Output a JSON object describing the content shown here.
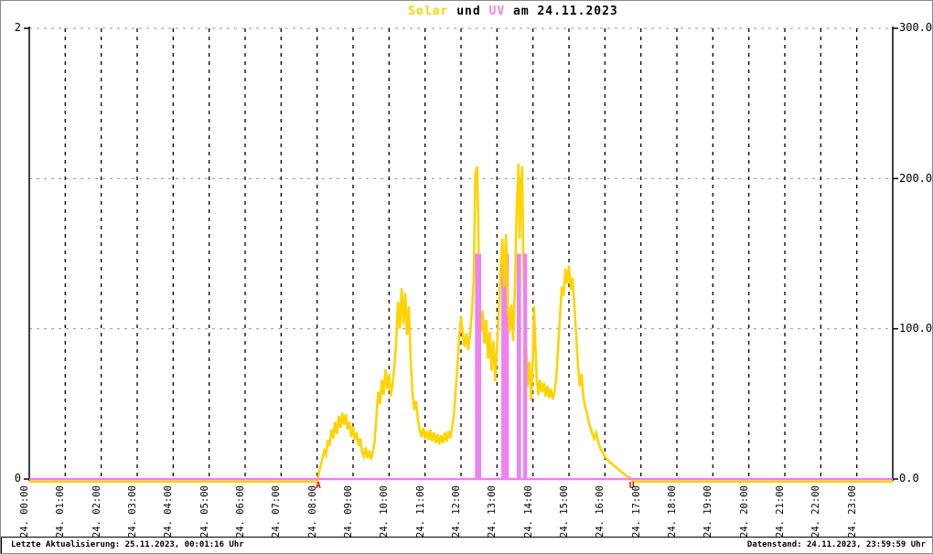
{
  "chart_data": {
    "type": "line",
    "title": "Solar und UV am 24.11.2023",
    "title_parts": [
      {
        "text": "Solar",
        "color": "#FFD300"
      },
      {
        "text": " und ",
        "color": "#000000"
      },
      {
        "text": "UV",
        "color": "#EE82EE"
      },
      {
        "text": " am 24.11.2023",
        "color": "#000000"
      }
    ],
    "grid": {
      "horizontal_style": "dashed-gray",
      "vertical_style": "dashed-black"
    },
    "legend_position": "none",
    "axes": {
      "left": {
        "series": "UV",
        "min": 0,
        "max": 2,
        "ticks": [
          "2",
          "0"
        ],
        "tick_values": [
          2,
          0
        ]
      },
      "right": {
        "series": "Solar",
        "min": 0,
        "max": 300,
        "ticks": [
          "300.0",
          "200.0",
          "100.0",
          "0.0"
        ],
        "tick_values": [
          300,
          200,
          100,
          0
        ],
        "gridline_values": [
          300,
          200,
          100
        ]
      },
      "x": {
        "min_hour": 0,
        "max_hour": 24,
        "tick_labels": [
          "24. 00:00",
          "24. 01:00",
          "24. 02:00",
          "24. 03:00",
          "24. 04:00",
          "24. 05:00",
          "24. 06:00",
          "24. 07:00",
          "24. 08:00",
          "24. 09:00",
          "24. 10:00",
          "24. 11:00",
          "24. 12:00",
          "24. 13:00",
          "24. 14:00",
          "24. 15:00",
          "24. 16:00",
          "24. 17:00",
          "24. 18:00",
          "24. 19:00",
          "24. 20:00",
          "24. 21:00",
          "24. 22:00",
          "24. 23:00"
        ]
      }
    },
    "series": [
      {
        "name": "Solar",
        "type": "line",
        "color": "#FFD300",
        "axis": "right",
        "points": [
          [
            0,
            0
          ],
          [
            8.0,
            0
          ],
          [
            8.05,
            4
          ],
          [
            8.1,
            9
          ],
          [
            8.15,
            14
          ],
          [
            8.2,
            19
          ],
          [
            8.25,
            16
          ],
          [
            8.3,
            26
          ],
          [
            8.35,
            22
          ],
          [
            8.4,
            33
          ],
          [
            8.45,
            27
          ],
          [
            8.5,
            38
          ],
          [
            8.55,
            30
          ],
          [
            8.6,
            42
          ],
          [
            8.65,
            34
          ],
          [
            8.7,
            44
          ],
          [
            8.75,
            36
          ],
          [
            8.8,
            43
          ],
          [
            8.85,
            33
          ],
          [
            8.9,
            38
          ],
          [
            8.95,
            28
          ],
          [
            9.0,
            35
          ],
          [
            9.05,
            26
          ],
          [
            9.1,
            31
          ],
          [
            9.15,
            22
          ],
          [
            9.2,
            27
          ],
          [
            9.25,
            18
          ],
          [
            9.3,
            15
          ],
          [
            9.35,
            21
          ],
          [
            9.4,
            14
          ],
          [
            9.45,
            19
          ],
          [
            9.5,
            13
          ],
          [
            9.55,
            18
          ],
          [
            9.6,
            25
          ],
          [
            9.65,
            42
          ],
          [
            9.7,
            58
          ],
          [
            9.75,
            50
          ],
          [
            9.8,
            66
          ],
          [
            9.85,
            56
          ],
          [
            9.9,
            73
          ],
          [
            9.95,
            60
          ],
          [
            10.0,
            70
          ],
          [
            10.05,
            55
          ],
          [
            10.1,
            64
          ],
          [
            10.15,
            75
          ],
          [
            10.2,
            92
          ],
          [
            10.25,
            118
          ],
          [
            10.3,
            100
          ],
          [
            10.35,
            127
          ],
          [
            10.4,
            103
          ],
          [
            10.45,
            124
          ],
          [
            10.5,
            96
          ],
          [
            10.55,
            115
          ],
          [
            10.6,
            80
          ],
          [
            10.65,
            58
          ],
          [
            10.7,
            46
          ],
          [
            10.75,
            52
          ],
          [
            10.8,
            40
          ],
          [
            10.85,
            33
          ],
          [
            10.9,
            28
          ],
          [
            10.95,
            34
          ],
          [
            11.0,
            27
          ],
          [
            11.05,
            32
          ],
          [
            11.1,
            26
          ],
          [
            11.15,
            33
          ],
          [
            11.2,
            25
          ],
          [
            11.25,
            31
          ],
          [
            11.3,
            24
          ],
          [
            11.35,
            30
          ],
          [
            11.4,
            23
          ],
          [
            11.45,
            29
          ],
          [
            11.5,
            24
          ],
          [
            11.55,
            31
          ],
          [
            11.6,
            25
          ],
          [
            11.65,
            32
          ],
          [
            11.7,
            27
          ],
          [
            11.75,
            34
          ],
          [
            11.8,
            42
          ],
          [
            11.85,
            58
          ],
          [
            11.9,
            75
          ],
          [
            11.95,
            94
          ],
          [
            12.0,
            108
          ],
          [
            12.05,
            96
          ],
          [
            12.1,
            88
          ],
          [
            12.15,
            97
          ],
          [
            12.2,
            86
          ],
          [
            12.25,
            95
          ],
          [
            12.3,
            110
          ],
          [
            12.35,
            132
          ],
          [
            12.4,
            204
          ],
          [
            12.45,
            208
          ],
          [
            12.48,
            170
          ],
          [
            12.5,
            128
          ],
          [
            12.55,
            98
          ],
          [
            12.6,
            112
          ],
          [
            12.65,
            90
          ],
          [
            12.7,
            106
          ],
          [
            12.75,
            80
          ],
          [
            12.8,
            98
          ],
          [
            12.85,
            72
          ],
          [
            12.9,
            92
          ],
          [
            12.95,
            65
          ],
          [
            13.0,
            88
          ],
          [
            13.05,
            112
          ],
          [
            13.1,
            140
          ],
          [
            13.15,
            160
          ],
          [
            13.2,
            128
          ],
          [
            13.25,
            163
          ],
          [
            13.3,
            118
          ],
          [
            13.35,
            98
          ],
          [
            13.4,
            116
          ],
          [
            13.45,
            92
          ],
          [
            13.5,
            130
          ],
          [
            13.55,
            182
          ],
          [
            13.6,
            210
          ],
          [
            13.63,
            160
          ],
          [
            13.67,
            196
          ],
          [
            13.7,
            208
          ],
          [
            13.73,
            150
          ],
          [
            13.76,
            120
          ],
          [
            13.8,
            95
          ],
          [
            13.85,
            62
          ],
          [
            13.9,
            78
          ],
          [
            13.95,
            52
          ],
          [
            14.0,
            82
          ],
          [
            14.03,
            115
          ],
          [
            14.06,
            95
          ],
          [
            14.1,
            68
          ],
          [
            14.15,
            56
          ],
          [
            14.2,
            66
          ],
          [
            14.25,
            58
          ],
          [
            14.3,
            64
          ],
          [
            14.35,
            55
          ],
          [
            14.4,
            62
          ],
          [
            14.45,
            54
          ],
          [
            14.5,
            60
          ],
          [
            14.55,
            53
          ],
          [
            14.6,
            58
          ],
          [
            14.65,
            68
          ],
          [
            14.7,
            88
          ],
          [
            14.75,
            108
          ],
          [
            14.8,
            128
          ],
          [
            14.85,
            122
          ],
          [
            14.9,
            140
          ],
          [
            14.95,
            130
          ],
          [
            15.0,
            142
          ],
          [
            15.05,
            126
          ],
          [
            15.1,
            134
          ],
          [
            15.15,
            116
          ],
          [
            15.2,
            96
          ],
          [
            15.25,
            76
          ],
          [
            15.3,
            62
          ],
          [
            15.35,
            70
          ],
          [
            15.4,
            55
          ],
          [
            15.45,
            48
          ],
          [
            15.5,
            44
          ],
          [
            15.55,
            38
          ],
          [
            15.6,
            34
          ],
          [
            15.65,
            30
          ],
          [
            15.7,
            27
          ],
          [
            15.75,
            31
          ],
          [
            15.8,
            26
          ],
          [
            15.85,
            22
          ],
          [
            15.9,
            19
          ],
          [
            15.95,
            17
          ],
          [
            16.0,
            15
          ],
          [
            16.1,
            12
          ],
          [
            16.2,
            10
          ],
          [
            16.3,
            8
          ],
          [
            16.4,
            6
          ],
          [
            16.5,
            4
          ],
          [
            16.6,
            2
          ],
          [
            16.7,
            1
          ],
          [
            16.78,
            0
          ],
          [
            24,
            0
          ]
        ]
      },
      {
        "name": "UV",
        "type": "bar",
        "color": "#EE82EE",
        "axis": "left",
        "baseline_value": 0,
        "bars": [
          {
            "start": 12.39,
            "end": 12.56,
            "value": 1.0,
            "front": true
          },
          {
            "start": 13.12,
            "end": 13.33,
            "value": 1.0,
            "front": false
          },
          {
            "start": 13.55,
            "end": 13.67,
            "value": 1.0,
            "front": true
          },
          {
            "start": 13.73,
            "end": 13.84,
            "value": 1.0,
            "front": true
          }
        ]
      }
    ],
    "sun_markers": [
      {
        "label": "A",
        "hour": 8.05,
        "color": "#DD0000"
      },
      {
        "label": "U",
        "hour": 16.76,
        "color": "#DD0000"
      }
    ]
  },
  "footer": {
    "left": "Letzte Aktualisierung: 25.11.2023, 00:01:16 Uhr",
    "right": "Datenstand: 24.11.2023, 23:59:59 Uhr"
  }
}
